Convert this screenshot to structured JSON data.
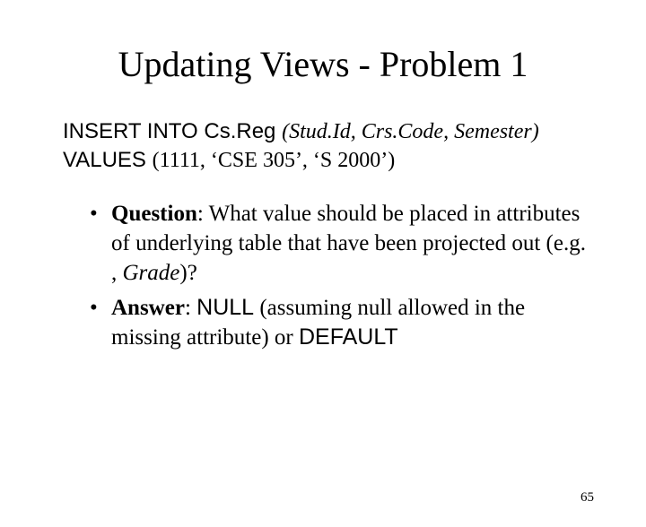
{
  "title": "Updating Views - Problem 1",
  "code": {
    "l1a": "INSERT INTO ",
    "l1b": "Cs.Reg ",
    "l1c": "(Stud.Id, Crs.Code, Semester)",
    "l2a": "VALUES ",
    "l2b": "(1111, ‘CSE 305’, ‘S 2000’)"
  },
  "bullets": {
    "q_label": "Question",
    "q_text1": ": What value should be placed in attributes of underlying table that have been projected out (e.g. , ",
    "q_grade": "Grade",
    "q_text2": ")?",
    "a_label": "Answer",
    "a_text1": ": ",
    "a_null": "NULL",
    "a_text2": " (assuming null allowed in the missing attribute) or ",
    "a_default": "DEFAULT"
  },
  "page_number": "65"
}
